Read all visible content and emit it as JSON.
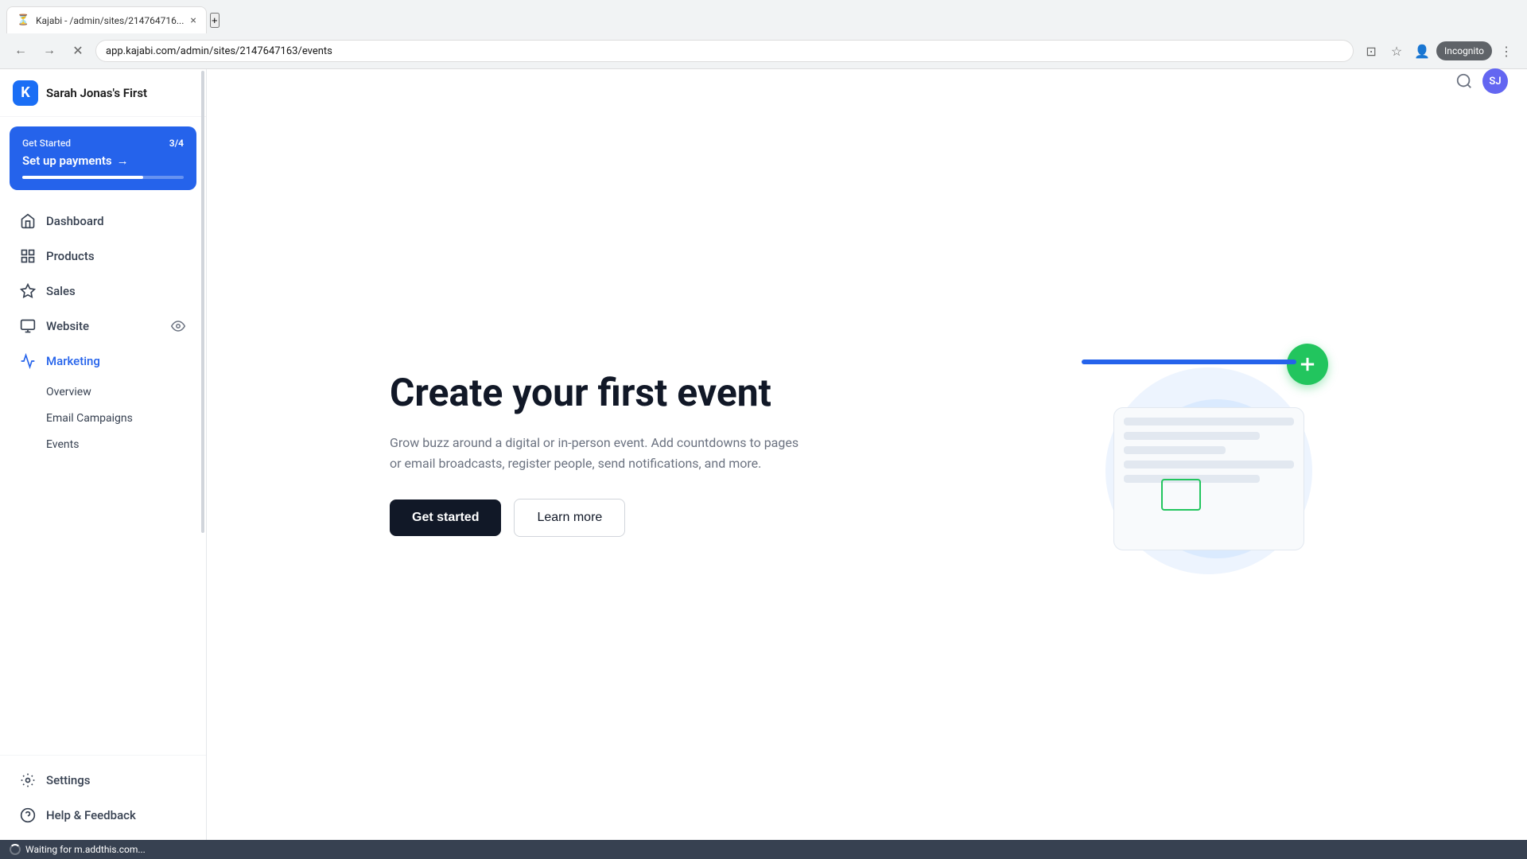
{
  "browser": {
    "tab_title": "Kajabi - /admin/sites/214764716...",
    "tab_favicon": "⏳",
    "close_icon": "×",
    "new_tab_icon": "+",
    "back_icon": "←",
    "forward_icon": "→",
    "reload_icon": "✕",
    "address": "app.kajabi.com/admin/sites/2147647163/events",
    "incognito_label": "Incognito"
  },
  "app": {
    "logo_letter": "K",
    "site_name": "Sarah Jonas's First",
    "user_initials": "SJ"
  },
  "sidebar": {
    "get_started": {
      "label": "Get Started",
      "progress": "3/4",
      "action": "Set up payments",
      "arrow": "→"
    },
    "nav_items": [
      {
        "id": "dashboard",
        "label": "Dashboard",
        "icon": "house"
      },
      {
        "id": "products",
        "label": "Products",
        "icon": "tag"
      },
      {
        "id": "sales",
        "label": "Sales",
        "icon": "diamond"
      },
      {
        "id": "website",
        "label": "Website",
        "icon": "monitor",
        "badge": "eye"
      },
      {
        "id": "marketing",
        "label": "Marketing",
        "icon": "megaphone",
        "active": true
      }
    ],
    "sub_nav": [
      {
        "id": "overview",
        "label": "Overview"
      },
      {
        "id": "email-campaigns",
        "label": "Email Campaigns"
      },
      {
        "id": "events",
        "label": "Events",
        "active": true
      }
    ],
    "bottom_nav": [
      {
        "id": "settings",
        "label": "Settings",
        "icon": "gear"
      },
      {
        "id": "help",
        "label": "Help & Feedback",
        "icon": "circle-question"
      }
    ]
  },
  "main": {
    "title": "Create your first event",
    "description": "Grow buzz around a digital or in-person event. Add countdowns to pages or email broadcasts, register people, send notifications, and more.",
    "btn_primary": "Get started",
    "btn_secondary": "Learn more"
  },
  "status_bar": {
    "text": "Waiting for m.addthis.com..."
  }
}
